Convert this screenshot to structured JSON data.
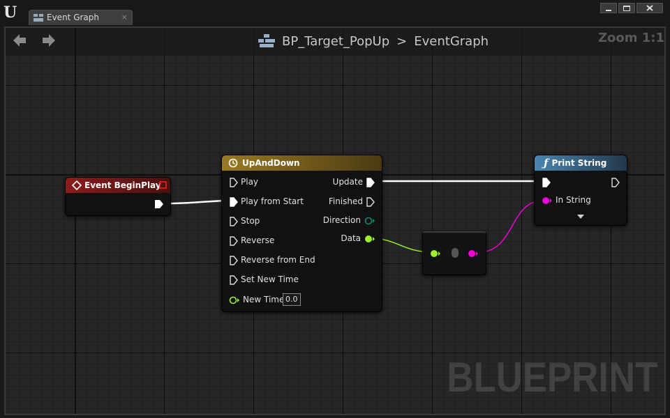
{
  "window": {
    "tab_title": "Event Graph",
    "tab_close": "×"
  },
  "navbar": {
    "breadcrumb": [
      "BP_Target_PopUp",
      "EventGraph"
    ],
    "separator": ">",
    "zoom": "Zoom 1:1"
  },
  "watermark": "BLUEPRINT",
  "nodes": {
    "event_begin_play": {
      "title": "Event BeginPlay",
      "header_color": "#7a1616"
    },
    "timeline": {
      "title": "UpAndDown",
      "header_color": "#8a6a1a",
      "inputs": [
        "Play",
        "Play from Start",
        "Stop",
        "Reverse",
        "Reverse from End",
        "Set New Time"
      ],
      "new_time_label": "New Time",
      "new_time_value": "0.0",
      "outputs": [
        "Update",
        "Finished",
        "Direction",
        "Data"
      ]
    },
    "print_string": {
      "title": "Print String",
      "header_color": "#3a6a8a",
      "in_string": "In String"
    }
  },
  "colors": {
    "exec_wire": "#ffffff",
    "float_pin": "#9ef02a",
    "string_pin": "#f000d8",
    "enum_pin": "#0a6a5a"
  }
}
